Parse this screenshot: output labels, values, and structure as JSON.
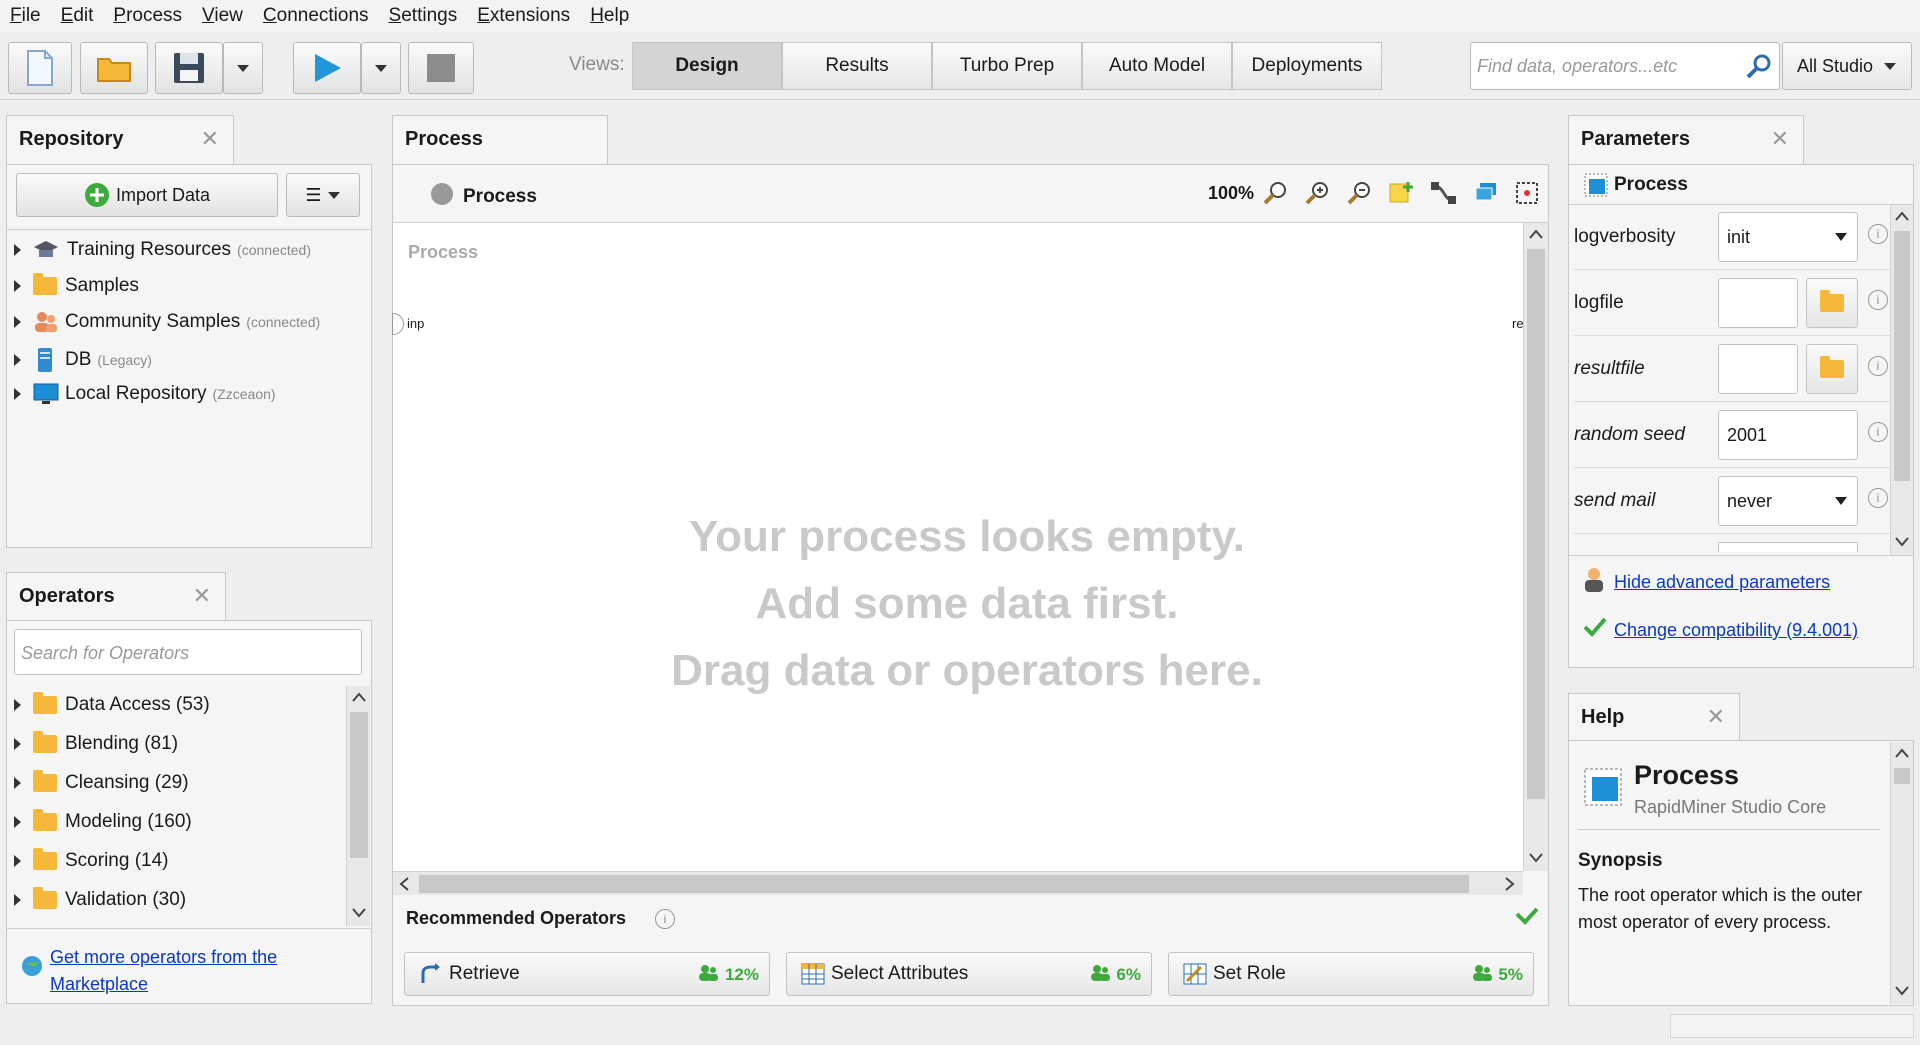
{
  "menu": [
    {
      "label": "File",
      "key": "F",
      "rest": "ile"
    },
    {
      "label": "Edit",
      "key": "E",
      "rest": "dit"
    },
    {
      "label": "Process",
      "key": "P",
      "rest": "rocess"
    },
    {
      "label": "View",
      "key": "V",
      "rest": "iew"
    },
    {
      "label": "Connections",
      "key": "C",
      "rest": "onnections"
    },
    {
      "label": "Settings",
      "key": "S",
      "rest": "ettings"
    },
    {
      "label": "Extensions",
      "key": "E",
      "rest": "xtensions"
    },
    {
      "label": "Help",
      "key": "H",
      "rest": "elp"
    }
  ],
  "toolbar": {
    "views_label": "Views:",
    "views": [
      "Design",
      "Results",
      "Turbo Prep",
      "Auto Model",
      "Deployments"
    ],
    "active_view": "Design",
    "search_placeholder": "Find data, operators...etc",
    "studio_selector": "All Studio"
  },
  "repository": {
    "tab": "Repository",
    "import_button": "Import Data",
    "items": [
      {
        "label": "Training Resources",
        "note": "(connected)"
      },
      {
        "label": "Samples",
        "note": ""
      },
      {
        "label": "Community Samples",
        "note": "(connected)"
      },
      {
        "label": "DB",
        "note": "(Legacy)"
      },
      {
        "label": "Local Repository",
        "note": "(Zzceaon)"
      }
    ]
  },
  "operators": {
    "tab": "Operators",
    "search_placeholder": "Search for Operators",
    "items": [
      "Data Access (53)",
      "Blending (81)",
      "Cleansing (29)",
      "Modeling (160)",
      "Scoring (14)",
      "Validation (30)"
    ],
    "marketplace_link_line1": "Get more operators from the",
    "marketplace_link_line2": "Marketplace"
  },
  "process": {
    "tab": "Process",
    "breadcrumb": "Process",
    "zoom": "100%",
    "canvas_label": "Process",
    "port_in": "inp",
    "port_out": "re",
    "empty_line1": "Your process looks empty.",
    "empty_line2": "Add some data first.",
    "empty_line3": "Drag data or operators here."
  },
  "recommended": {
    "title": "Recommended Operators",
    "items": [
      {
        "label": "Retrieve",
        "pct": "12%"
      },
      {
        "label": "Select Attributes",
        "pct": "6%"
      },
      {
        "label": "Set Role",
        "pct": "5%"
      }
    ]
  },
  "parameters": {
    "tab": "Parameters",
    "operator": "Process",
    "rows": [
      {
        "label": "logverbosity",
        "value": "init"
      },
      {
        "label": "logfile",
        "value": ""
      },
      {
        "label": "resultfile",
        "value": ""
      },
      {
        "label": "random seed",
        "value": "2001"
      },
      {
        "label": "send mail",
        "value": "never"
      }
    ],
    "hide_advanced": "Hide advanced parameters",
    "change_compat": "Change compatibility (9.4.001)"
  },
  "help": {
    "tab": "Help",
    "title": "Process",
    "subtitle": "RapidMiner Studio Core",
    "synopsis_heading": "Synopsis",
    "synopsis": "The root operator which is the outer most operator of every process."
  },
  "colors": {
    "accent": "#1e90d6",
    "link": "#0a37c8",
    "green": "#3caa3c",
    "folder": "#f5b83b"
  }
}
